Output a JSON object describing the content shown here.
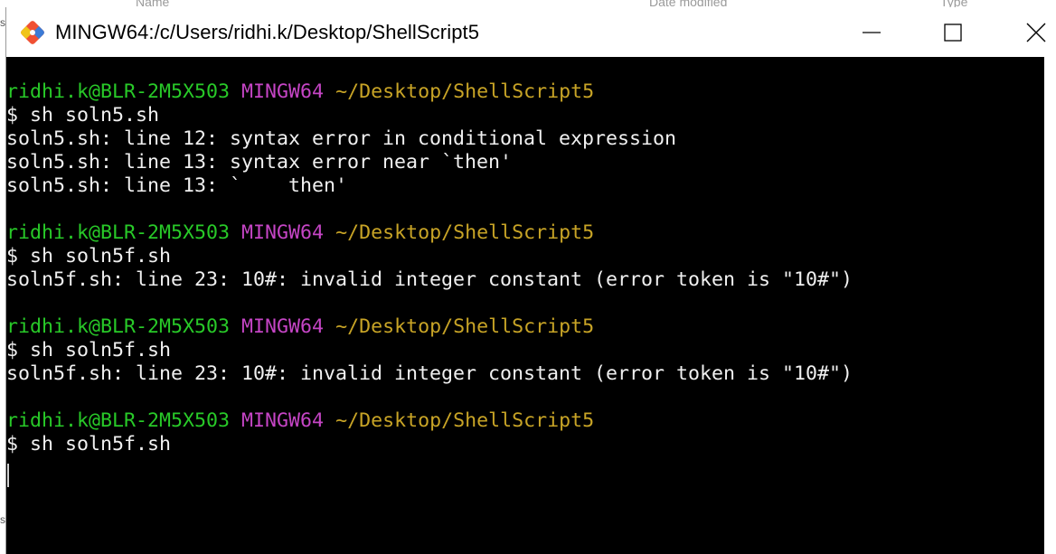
{
  "background": {
    "explorer_columns": [
      "Name",
      "Date modified",
      "Type"
    ],
    "left_letters": [
      "s",
      "s"
    ]
  },
  "window": {
    "title": "MINGW64:/c/Users/ridhi.k/Desktop/ShellScript5",
    "app_icon": "git-bash-icon",
    "controls": {
      "minimize": "minimize-icon",
      "maximize": "maximize-icon",
      "close": "close-icon"
    }
  },
  "colors": {
    "user_host": "#28c928",
    "system": "#c545c5",
    "path": "#c8a426",
    "text": "#f0f0f0",
    "background": "#000000"
  },
  "prompt": {
    "user_host": "ridhi.k@BLR-2M5X503",
    "system": "MINGW64",
    "path": "~/Desktop/ShellScript5"
  },
  "session": [
    {
      "command": "$ sh soln5.sh",
      "output": [
        "soln5.sh: line 12: syntax error in conditional expression",
        "soln5.sh: line 13: syntax error near `then'",
        "soln5.sh: line 13: `    then'"
      ]
    },
    {
      "command": "$ sh soln5f.sh",
      "output": [
        "soln5f.sh: line 23: 10#: invalid integer constant (error token is \"10#\")"
      ]
    },
    {
      "command": "$ sh soln5f.sh",
      "output": [
        "soln5f.sh: line 23: 10#: invalid integer constant (error token is \"10#\")"
      ]
    },
    {
      "command": "$ sh soln5f.sh",
      "output": []
    }
  ]
}
